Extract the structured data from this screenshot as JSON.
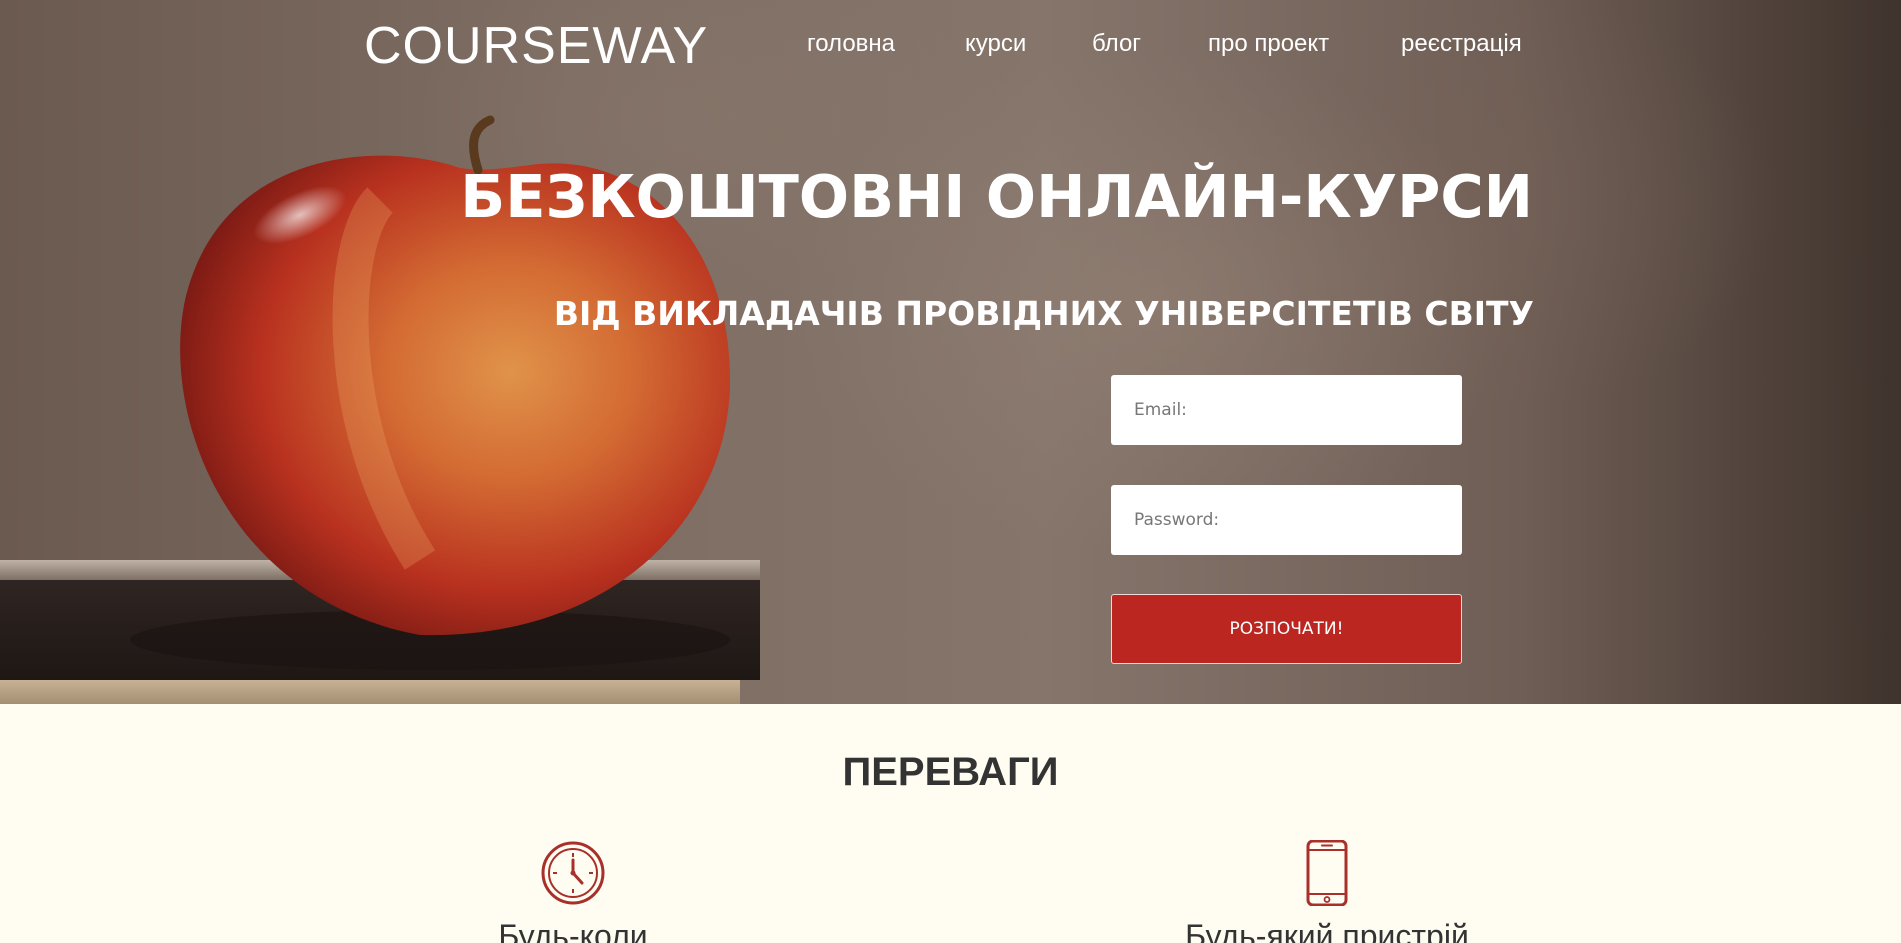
{
  "brand": {
    "logo_text": "COURSEWAY"
  },
  "nav": {
    "items": [
      {
        "label": "головна"
      },
      {
        "label": "курси"
      },
      {
        "label": "блог"
      },
      {
        "label": "про проект"
      },
      {
        "label": "реєстрація"
      }
    ]
  },
  "hero": {
    "headline": "БЕЗКОШТОВНІ ОНЛАЙН-КУРСИ",
    "subheadline": "ВІД ВИКЛАДАЧІВ ПРОВІДНИХ УНІВЕРСІТЕТІВ СВІТУ",
    "form": {
      "email_placeholder": "Email:",
      "password_placeholder": "Password:",
      "submit_label": "РОЗПОЧАТИ!"
    }
  },
  "advantages": {
    "title": "ПЕРЕВАГИ",
    "items": [
      {
        "icon": "clock-icon",
        "label": "Будь-коли"
      },
      {
        "icon": "smartphone-icon",
        "label": "Будь-який пристрій"
      }
    ]
  },
  "colors": {
    "accent": "#bb2621",
    "icon": "#a8302b",
    "section_background": "#fffcf1"
  }
}
